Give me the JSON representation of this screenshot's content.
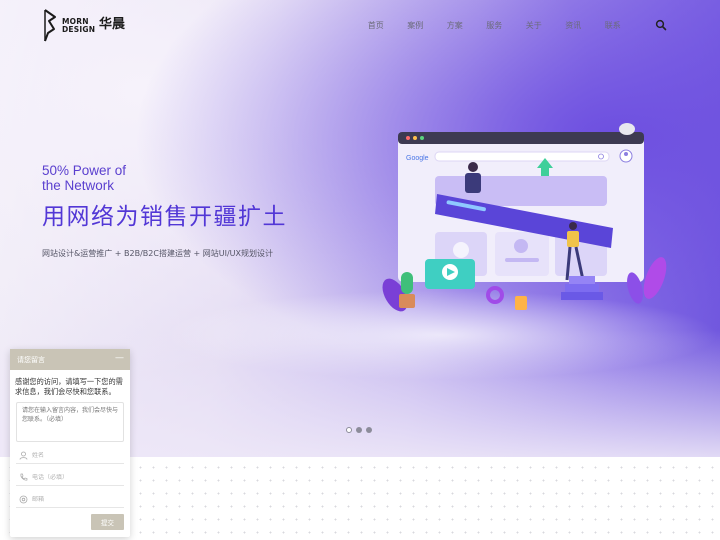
{
  "brand": {
    "name_en_line1": "MORN",
    "name_en_line2": "DESIGN",
    "name_cn": "华晨",
    "logo_icon": "bird-head-logo"
  },
  "nav": {
    "items": [
      "首页",
      "案例",
      "方案",
      "服务",
      "关于",
      "资讯",
      "联系"
    ],
    "search_icon": "search-icon"
  },
  "hero": {
    "slogan_en_line1": "50% Power of",
    "slogan_en_line2": "the Network",
    "slogan_cn": "用网络为销售开疆扩土",
    "services": "网站设计&运营推广 + B2B/B2C搭建运营 + 网站UI/UX规划设计",
    "illustration_icon": "web-design-illustration",
    "browser_brand": "Google",
    "slider": {
      "count": 3,
      "active": 1
    }
  },
  "chat": {
    "title": "请您留言",
    "minimize_label": "—",
    "intro": "感谢您的访问，请填写一下您的需求信息，我们会尽快和您联系。",
    "message_placeholder": "请您在输入留言内容，我们会尽快与您联系。（必填）",
    "name_placeholder": "姓名",
    "phone_placeholder": "电话（必填）",
    "email_placeholder": "邮箱",
    "submit_label": "提交"
  },
  "colors": {
    "accent": "#5237d6",
    "chat_header": "#c9c4b6",
    "nav_text": "#6b6b7a"
  }
}
